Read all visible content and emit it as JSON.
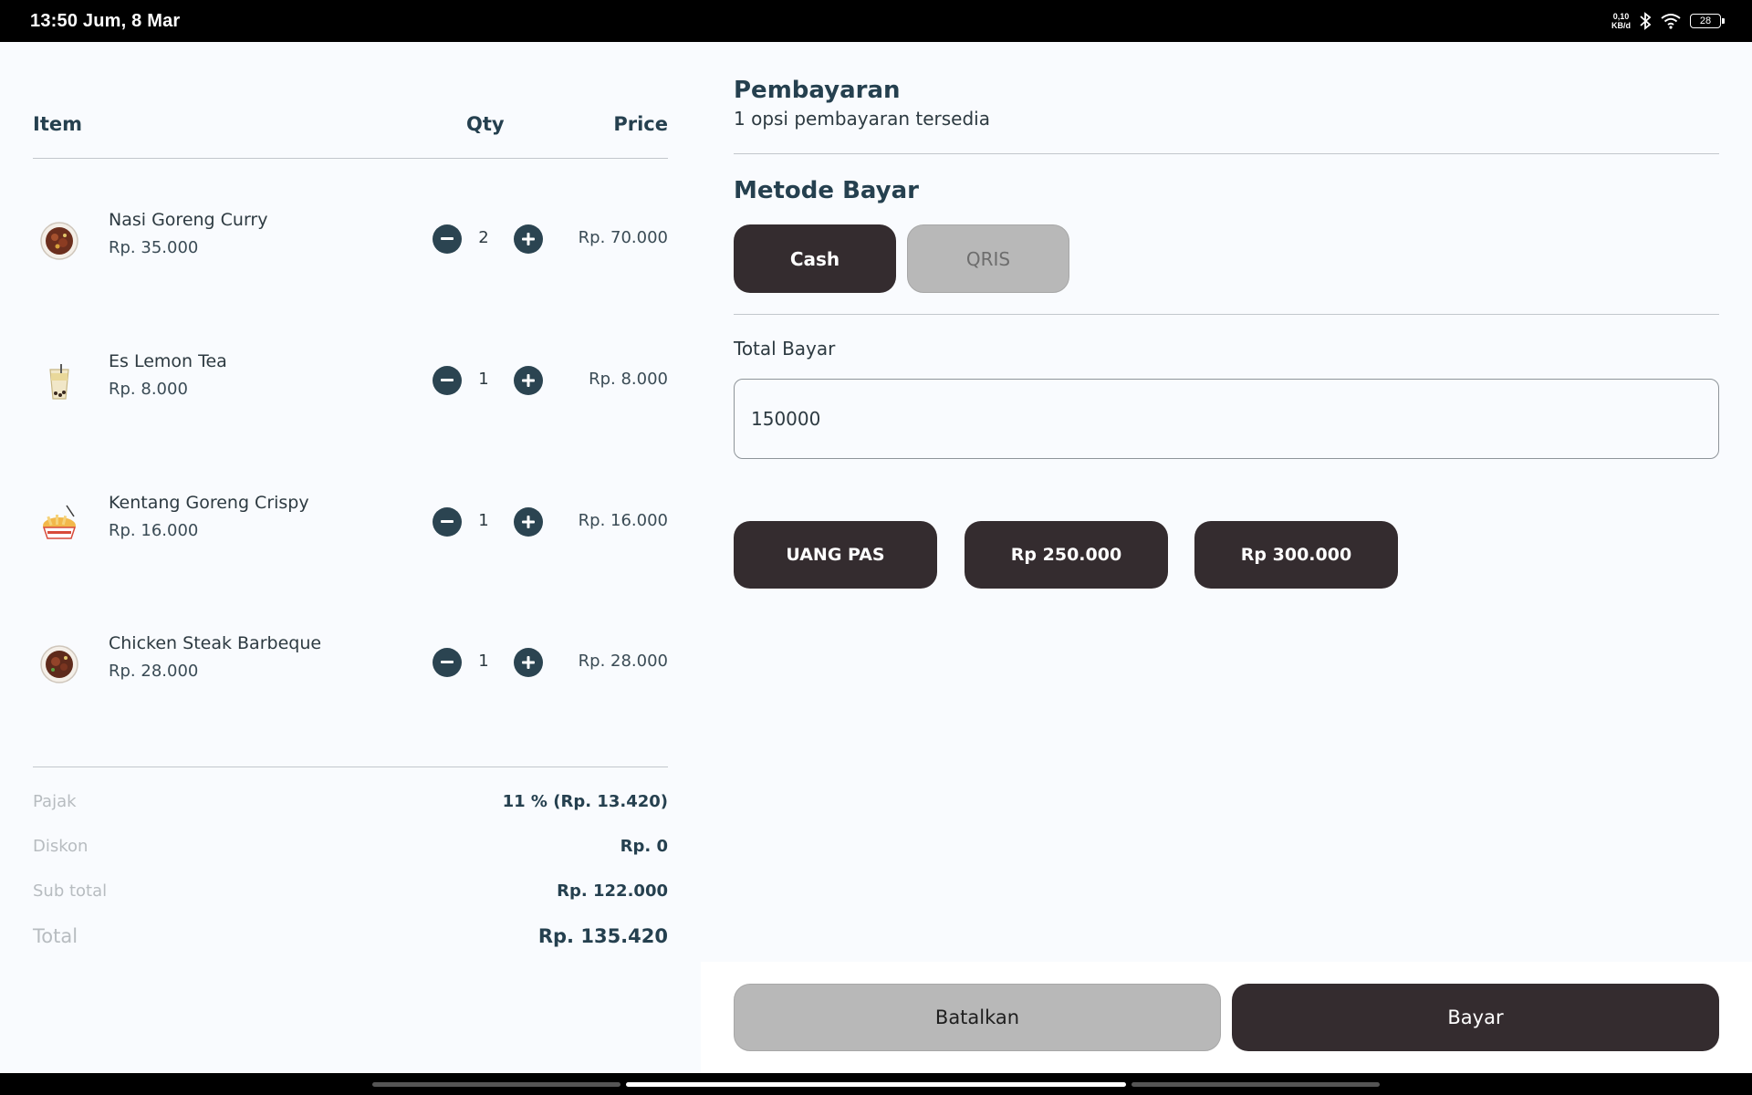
{
  "status_bar": {
    "clock": "13:50 Jum, 8 Mar",
    "net_speed_value": "0,10",
    "net_speed_unit": "KB/d",
    "battery": "28"
  },
  "cart": {
    "headers": {
      "item": "Item",
      "qty": "Qty",
      "price": "Price"
    },
    "items": [
      {
        "name": "Nasi Goreng Curry",
        "unit_price": "Rp. 35.000",
        "qty": "2",
        "total": "Rp. 70.000",
        "icon": "fried-rice-icon"
      },
      {
        "name": "Es Lemon Tea",
        "unit_price": "Rp. 8.000",
        "qty": "1",
        "total": "Rp. 8.000",
        "icon": "iced-tea-icon"
      },
      {
        "name": "Kentang Goreng Crispy",
        "unit_price": "Rp. 16.000",
        "qty": "1",
        "total": "Rp. 16.000",
        "icon": "french-fries-icon"
      },
      {
        "name": "Chicken Steak Barbeque",
        "unit_price": "Rp. 28.000",
        "qty": "1",
        "total": "Rp. 28.000",
        "icon": "steak-icon"
      }
    ],
    "summary": {
      "tax_label": "Pajak",
      "tax_value": "11 % (Rp. 13.420)",
      "discount_label": "Diskon",
      "discount_value": "Rp. 0",
      "subtotal_label": "Sub total",
      "subtotal_value": "Rp. 122.000",
      "total_label": "Total",
      "total_value": "Rp. 135.420"
    }
  },
  "payment": {
    "title": "Pembayaran",
    "subtitle": "1 opsi pembayaran tersedia",
    "method_title": "Metode Bayar",
    "methods": [
      {
        "label": "Cash",
        "selected": true
      },
      {
        "label": "QRIS",
        "selected": false
      }
    ],
    "total_label": "Total Bayar",
    "total_value": "150000",
    "quick_amounts": [
      "UANG PAS",
      "Rp 250.000",
      "Rp 300.000"
    ],
    "cancel_label": "Batalkan",
    "pay_label": "Bayar"
  },
  "colors": {
    "primary_dark": "#342c2f",
    "accent_teal": "#2b4451",
    "disabled": "#b8b8b8",
    "background": "#f9fbfe"
  }
}
